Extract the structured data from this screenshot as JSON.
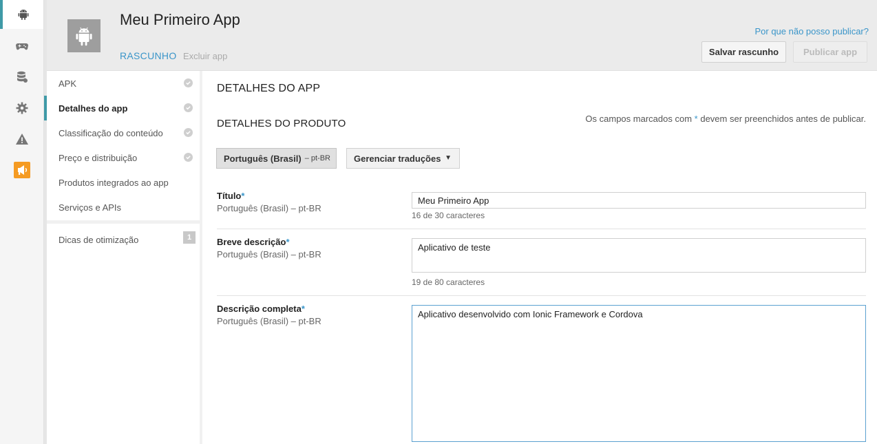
{
  "rail": {
    "items": [
      {
        "name": "android-icon",
        "active": true
      },
      {
        "name": "gamepad-icon",
        "active": false
      },
      {
        "name": "database-icon",
        "active": false
      },
      {
        "name": "gear-icon",
        "active": false
      },
      {
        "name": "warning-icon",
        "active": false
      },
      {
        "name": "megaphone-icon",
        "active": false
      }
    ],
    "accent_color": "#3f9aa7",
    "promo_color": "#f59b23"
  },
  "header": {
    "app_title": "Meu Primeiro App",
    "status": "RASCUNHO",
    "delete_link": "Excluir app",
    "why_link": "Por que não posso publicar?",
    "save_button": "Salvar rascunho",
    "publish_button": "Publicar app"
  },
  "nav": {
    "items": [
      {
        "label": "APK",
        "checked": true
      },
      {
        "label": "Detalhes do app",
        "checked": true,
        "active": true
      },
      {
        "label": "Classificação do conteúdo",
        "checked": true
      },
      {
        "label": "Preço e distribuição",
        "checked": true
      },
      {
        "label": "Produtos integrados ao app",
        "checked": false
      },
      {
        "label": "Serviços e APIs",
        "checked": false
      }
    ],
    "tips": {
      "label": "Dicas de otimização",
      "badge": "1"
    }
  },
  "main": {
    "section_title": "DETALHES DO APP",
    "sub_title": "DETALHES DO PRODUTO",
    "required_note_prefix": "Os campos marcados com",
    "required_note_star": "*",
    "required_note_suffix": "devem ser preenchidos antes de publicar.",
    "language_button": "Português (Brasil)",
    "language_code": "– pt-BR",
    "manage_translations": "Gerenciar traduções",
    "fields": [
      {
        "label": "Título",
        "star": "*",
        "lang": "Português (Brasil) – pt-BR",
        "value": "Meu Primeiro App",
        "counter": "16 de 30 caracteres"
      },
      {
        "label": "Breve descrição",
        "star": "*",
        "lang": "Português (Brasil) – pt-BR",
        "value": "Aplicativo de teste",
        "counter": "19 de 80 caracteres"
      },
      {
        "label": "Descrição completa",
        "star": "*",
        "lang": "Português (Brasil) – pt-BR",
        "value": "Aplicativo desenvolvido com Ionic Framework e Cordova"
      }
    ]
  }
}
